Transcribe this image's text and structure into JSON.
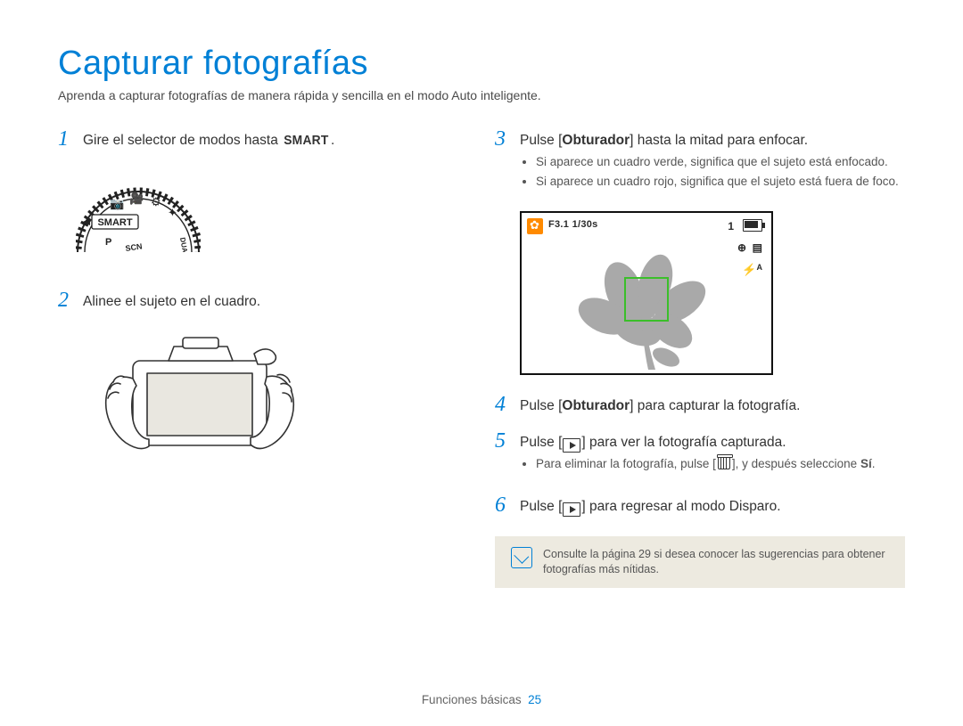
{
  "title": "Capturar fotografías",
  "subtitle": "Aprenda a capturar fotografías de manera rápida y sencilla en el modo Auto inteligente.",
  "left": {
    "step1": {
      "num": "1",
      "pre": "Gire el selector de modos hasta ",
      "smart": "SMART",
      "post": "."
    },
    "step2": {
      "num": "2",
      "text": "Alinee el sujeto en el cuadro."
    }
  },
  "right": {
    "step3": {
      "num": "3",
      "pre": "Pulse [",
      "bold": "Obturador",
      "post": "] hasta la mitad para enfocar.",
      "bul1": "Si aparece un cuadro verde, significa que el sujeto está enfocado.",
      "bul2": "Si aparece un cuadro rojo, significa que el sujeto está fuera de foco."
    },
    "lcd": {
      "fline": "F3.1  1/30s",
      "count": "1"
    },
    "step4": {
      "num": "4",
      "pre": "Pulse [",
      "bold": "Obturador",
      "post": "] para capturar la fotografía."
    },
    "step5": {
      "num": "5",
      "pre": "Pulse [",
      "post": "] para ver la fotografía capturada.",
      "bul_pre": "Para eliminar la fotografía, pulse [",
      "bul_mid": "], y después seleccione ",
      "bul_bold": "Sí",
      "bul_end": "."
    },
    "step6": {
      "num": "6",
      "pre": "Pulse [",
      "post": "] para regresar al modo Disparo."
    },
    "tip": "Consulte la página 29 si desea conocer las sugerencias para obtener fotografías más nítidas."
  },
  "dial": {
    "smart_label": "SMART",
    "scn": "SCN",
    "p": "P",
    "dual": "DUAL"
  },
  "footer": {
    "section": "Funciones básicas",
    "page": "25"
  }
}
